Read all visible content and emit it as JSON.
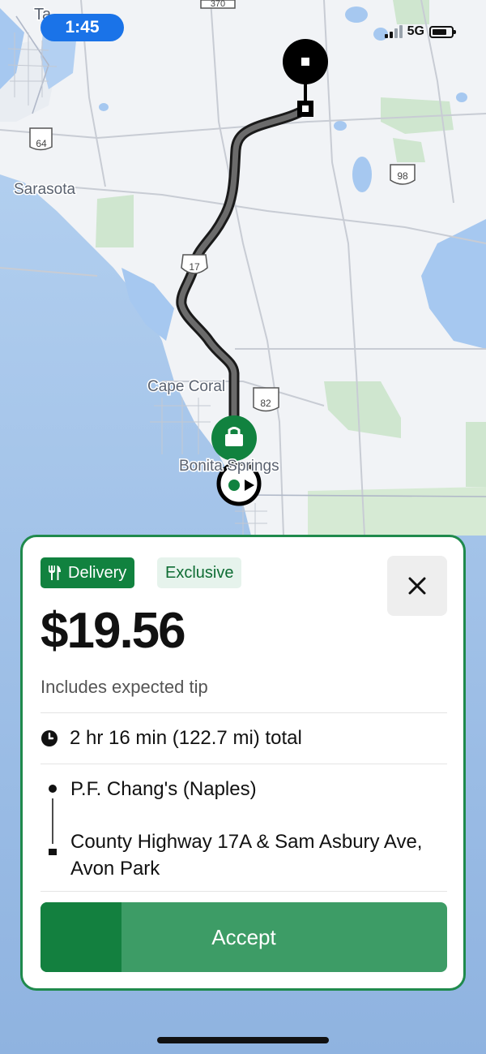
{
  "status_bar": {
    "time": "1:45",
    "network": "5G",
    "signal_bars": 2
  },
  "map": {
    "labels": {
      "sarasota": "Sarasota",
      "cape_coral": "Cape Coral",
      "bonita_springs": "Bonita Springs",
      "tampa_partial": "Ta"
    },
    "shields": {
      "sr64": "64",
      "us17": "17",
      "sr98": "98",
      "sr82": "82",
      "top_partial": "370"
    }
  },
  "offer": {
    "tag_delivery": "Delivery",
    "tag_exclusive": "Exclusive",
    "price": "$19.56",
    "tip_note": "Includes expected tip",
    "duration": "2 hr 16 min (122.7 mi) total",
    "pickup": "P.F. Chang's (Naples)",
    "dropoff": "County Highway 17A & Sam Asbury Ave, Avon Park",
    "accept_label": "Accept",
    "accept_progress": 0.2
  },
  "colors": {
    "accent": "#11823f",
    "accept": "#3d9c66",
    "route": "#555555",
    "water": "#a6c8f0",
    "land": "#f1f3f6"
  }
}
